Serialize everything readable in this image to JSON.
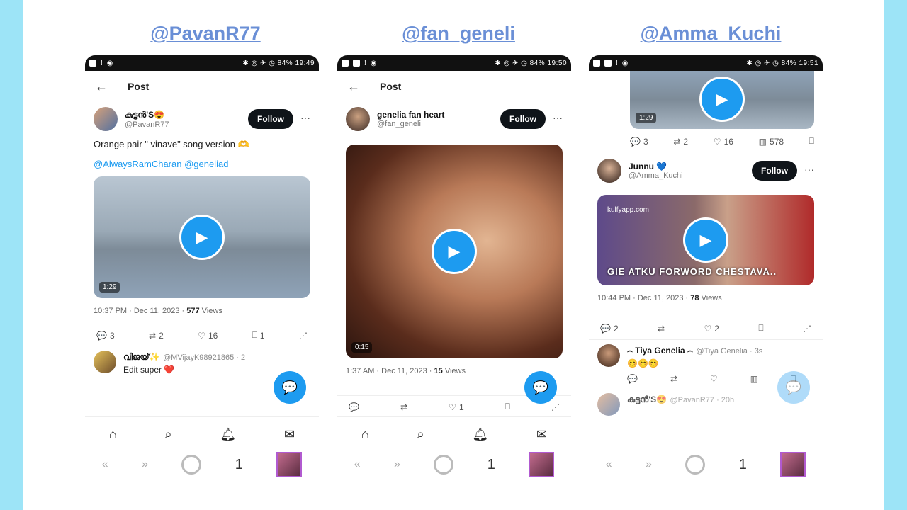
{
  "handles": [
    "@PavanR77",
    "@fan_geneli",
    "@Amma_Kuchi"
  ],
  "phone1": {
    "status_time": "✱ ◎ ✈ ◷ 84% 19:49",
    "nav_title": "Post",
    "author": {
      "display_name": "കുട്ടൻ'S😍",
      "username": "@PavanR77"
    },
    "follow_label": "Follow",
    "text": "Orange pair \" vinave\" song version 🫶",
    "mentions": "@AlwaysRamCharan  @geneliad",
    "duration": "1:29",
    "timestamp": "10:37 PM · Dec 11, 2023 · ",
    "views_count": "577",
    "views_label": " Views",
    "actions": {
      "replies": "3",
      "retweets": "2",
      "likes": "16",
      "bookmarks": "1"
    },
    "reply": {
      "name": "വിജയ്✨",
      "handle": "@MVijayK98921865 · 2",
      "text": "Edit super ❤️"
    }
  },
  "phone2": {
    "status_time": "✱ ◎ ✈ ◷ 84% 19:50",
    "nav_title": "Post",
    "author": {
      "display_name": "genelia fan heart",
      "username": "@fan_geneli"
    },
    "follow_label": "Follow",
    "duration": "0:15",
    "timestamp": "1:37 AM · Dec 11, 2023 · ",
    "views_count": "15",
    "views_label": " Views",
    "actions": {
      "likes": "1"
    }
  },
  "phone3": {
    "status_time": "✱ ◎ ✈ ◷ 84% 19:51",
    "top_duration": "1:29",
    "top_actions": {
      "replies": "3",
      "retweets": "2",
      "likes": "16",
      "views": "578"
    },
    "author": {
      "display_name": "Junnu 💙",
      "username": "@Amma_Kuchi"
    },
    "follow_label": "Follow",
    "video_watermark": "kulfyapp.com",
    "video_caption": "GIE ATKU FORWORD CHESTAVA..",
    "timestamp": "10:44 PM · Dec 11, 2023 · ",
    "views_count": "78",
    "views_label": " Views",
    "actions": {
      "replies": "2",
      "likes": "2"
    },
    "reply": {
      "name": "⌢ Tiya Genelia ⌢",
      "handle": "@Tiya Genelia · 3s",
      "text": "😊😊😊"
    },
    "next_reply": {
      "name": "കുട്ടൻ'S😍",
      "handle": "@PavanR77 · 20h"
    }
  },
  "sysnav_number": "1"
}
